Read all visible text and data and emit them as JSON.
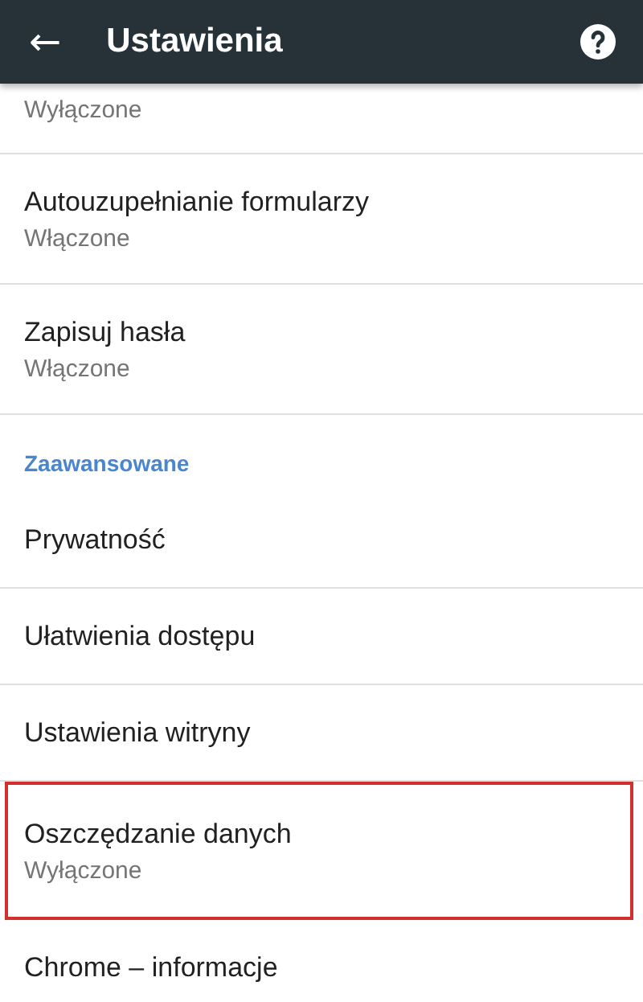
{
  "app_bar": {
    "back": "←",
    "title": "Ustawienia"
  },
  "items": [
    {
      "kind": "setting",
      "subtitle": "Wyłączone",
      "highlighted": false,
      "partial": true
    },
    {
      "kind": "setting",
      "title": "Autouzupełnianie formularzy",
      "subtitle": "Włączone",
      "highlighted": false
    },
    {
      "kind": "setting",
      "title": "Zapisuj hasła",
      "subtitle": "Włączone",
      "highlighted": false
    },
    {
      "kind": "section",
      "title": "Zaawansowane"
    },
    {
      "kind": "setting",
      "title": "Prywatność",
      "highlighted": false
    },
    {
      "kind": "setting",
      "title": "Ułatwienia dostępu",
      "highlighted": false
    },
    {
      "kind": "setting",
      "title": "Ustawienia witryny",
      "highlighted": false
    },
    {
      "kind": "setting",
      "title": "Oszczędzanie danych",
      "subtitle": "Wyłączone",
      "highlighted": true
    },
    {
      "kind": "setting",
      "title": "Chrome – informacje",
      "highlighted": false
    }
  ]
}
